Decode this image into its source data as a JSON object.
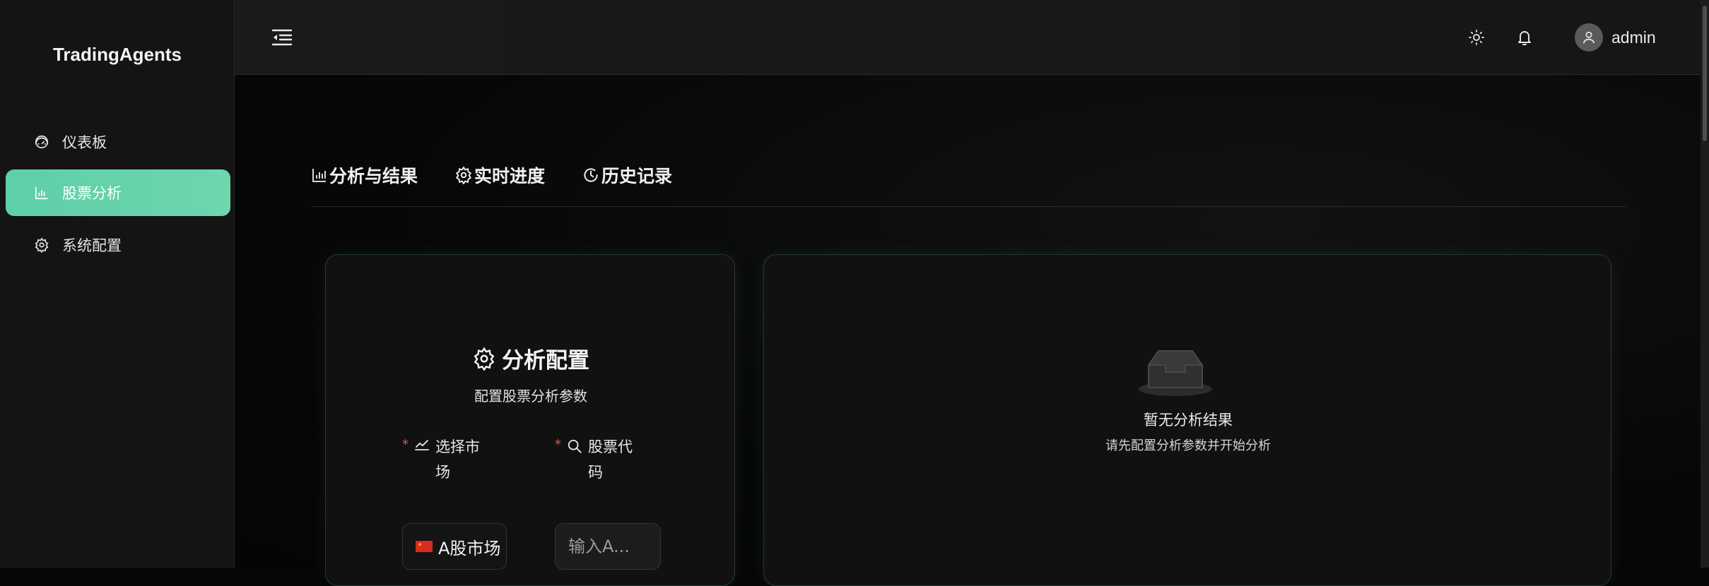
{
  "app": {
    "brand": "TradingAgents"
  },
  "sidebar": {
    "items": [
      {
        "label": "仪表板",
        "icon": "dashboard-icon",
        "active": false
      },
      {
        "label": "股票分析",
        "icon": "bar-chart-icon",
        "active": true
      },
      {
        "label": "系统配置",
        "icon": "gear-icon",
        "active": false
      }
    ]
  },
  "header": {
    "menu_icon": "menu-fold-icon",
    "theme_icon": "sun-icon",
    "notification_icon": "bell-icon",
    "username": "admin"
  },
  "tabs": [
    {
      "label": "分析与结果",
      "icon": "bar-chart-icon"
    },
    {
      "label": "实时进度",
      "icon": "gear-icon"
    },
    {
      "label": "历史记录",
      "icon": "clock-icon"
    }
  ],
  "config": {
    "title": "分析配置",
    "subtitle": "配置股票分析参数",
    "market_label": "选择市场",
    "code_label": "股票代码",
    "market_value": "A股市场",
    "code_placeholder": "输入A..."
  },
  "results": {
    "empty_title": "暂无分析结果",
    "empty_subtitle": "请先配置分析参数并开始分析"
  },
  "colors": {
    "accent": "#63d1a9",
    "background": "#060606",
    "sidebar": "#141414",
    "required": "#e05a4a"
  }
}
